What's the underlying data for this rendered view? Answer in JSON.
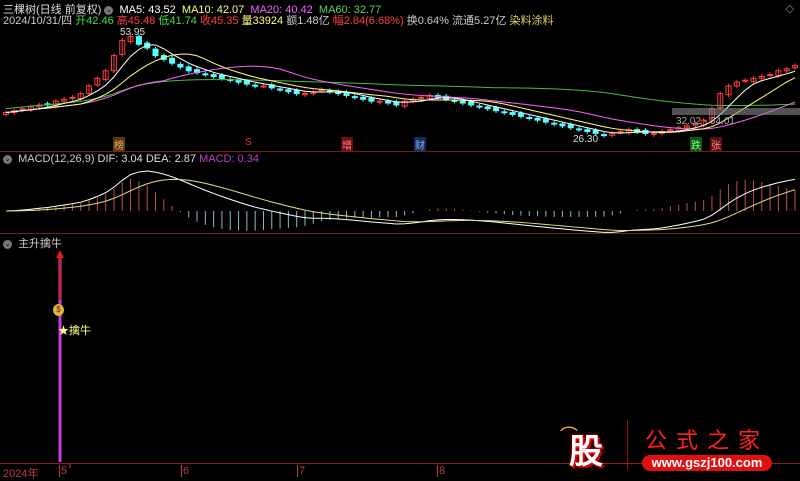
{
  "header": {
    "title": "三棵树(日线 前复权)",
    "ma5": "MA5: 43.52",
    "ma10": "MA10: 42.07",
    "ma20": "MA20: 40.42",
    "ma60": "MA60: 32.77",
    "date": "2024/10/31/四",
    "open": "开42.46",
    "high": "高45.48",
    "low": "低41.74",
    "close": "收45.35",
    "volume": "量33924",
    "amount": "额1.48亿",
    "change": "幅2.84(6.68%)",
    "turnover": "换0.64%",
    "float": "流通5.27亿",
    "sector": "染料涂料"
  },
  "price_panel": {
    "max_label": "53.95",
    "min_label": "26.30",
    "range_label": "32.02 - 34.01",
    "events": [
      "榜",
      "S",
      "增",
      "财",
      "跌",
      "张"
    ]
  },
  "macd_panel": {
    "title": "MACD(12,26,9)",
    "dif": "DIF: 3.04",
    "dea": "DEA: 2.87",
    "macd": "MACD: 0.34"
  },
  "signal_panel": {
    "title": "主升擒牛",
    "signal_label": "★擒牛"
  },
  "axis": {
    "year": "2024年",
    "months": [
      "5",
      "6",
      "7",
      "8"
    ]
  },
  "watermark": {
    "logo": "股",
    "name": "公式之家",
    "url": "www.gszj100.com"
  },
  "colors": {
    "up": "#ff3c3c",
    "down": "#54ffff",
    "ma5": "#ffffff",
    "ma10": "#ffff80",
    "ma20": "#ff60ff",
    "ma60": "#40c040"
  },
  "chart_data": {
    "type": "candlestick",
    "title": "三棵树(日线 前复权)",
    "closes": [
      33,
      33.5,
      34,
      34.5,
      35,
      35,
      36,
      36.5,
      37,
      38,
      40,
      42,
      44,
      48,
      52,
      53,
      51,
      50,
      48,
      47,
      46,
      45,
      44,
      43.5,
      43,
      42.5,
      42,
      41.5,
      41,
      40.5,
      40,
      40,
      39.5,
      39,
      38.5,
      38,
      38,
      38.5,
      39,
      38.5,
      38,
      37.5,
      37,
      36.5,
      36,
      36,
      35.5,
      35,
      36,
      36.5,
      37,
      37.5,
      37,
      36.5,
      36,
      35.5,
      35,
      34.5,
      34,
      33.5,
      33,
      32.5,
      32,
      31.5,
      31,
      30.5,
      30,
      29.5,
      29,
      28.5,
      28,
      27.5,
      27,
      27.5,
      28,
      28.5,
      28,
      27.5,
      27.5,
      28,
      28.5,
      29,
      29.5,
      30,
      31,
      34,
      38,
      40,
      41,
      41.5,
      42,
      42.5,
      43,
      44,
      44.5,
      45.35
    ],
    "ylim": [
      24,
      56
    ],
    "max": 53.95,
    "min": 26.3
  }
}
